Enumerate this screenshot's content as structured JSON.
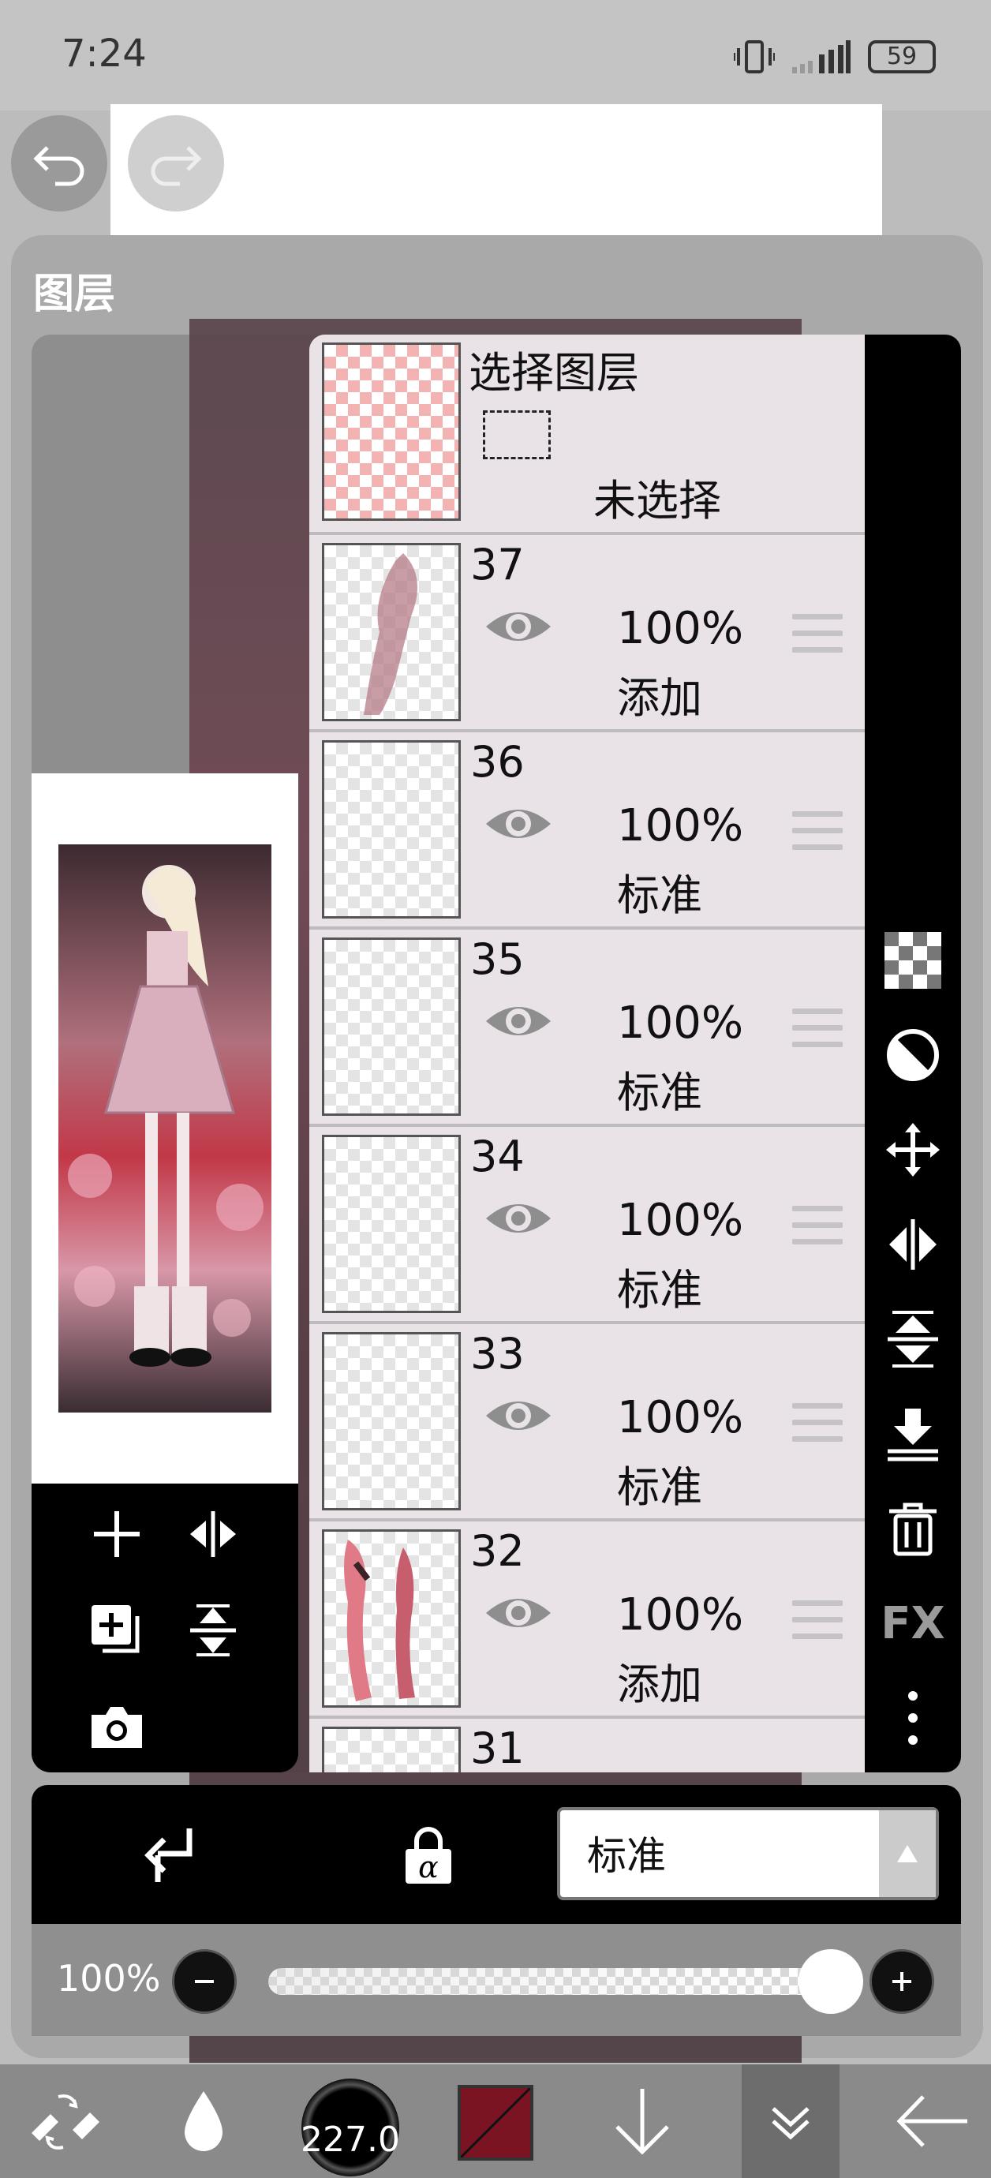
{
  "status_bar": {
    "time": "7:24",
    "battery": "59"
  },
  "panel": {
    "title": "图层"
  },
  "selection_layer": {
    "label": "选择图层",
    "state": "未选择"
  },
  "layers": [
    {
      "number": "37",
      "opacity": "100%",
      "blend": "添加",
      "thumb": "pink-figure"
    },
    {
      "number": "36",
      "opacity": "100%",
      "blend": "标准",
      "thumb": "empty"
    },
    {
      "number": "35",
      "opacity": "100%",
      "blend": "标准",
      "thumb": "empty"
    },
    {
      "number": "34",
      "opacity": "100%",
      "blend": "标准",
      "thumb": "empty"
    },
    {
      "number": "33",
      "opacity": "100%",
      "blend": "标准",
      "thumb": "empty"
    },
    {
      "number": "32",
      "opacity": "100%",
      "blend": "添加",
      "thumb": "pink-legs"
    },
    {
      "number": "31",
      "opacity": "",
      "blend": "",
      "thumb": "empty"
    }
  ],
  "right_toolbar": {
    "icons": [
      "checker-icon",
      "half-circle-icon",
      "move-icon",
      "flip-horizontal-icon",
      "flip-vertical-icon",
      "merge-down-icon",
      "trash-icon",
      "fx-icon",
      "more-icon"
    ],
    "fx_label": "FX"
  },
  "bottom_controls": {
    "blend_mode": "标准"
  },
  "opacity_slider": {
    "label": "100%",
    "value": 1.0
  },
  "bottom_bar": {
    "brush_size": "227.0",
    "color": "#7a1423"
  }
}
